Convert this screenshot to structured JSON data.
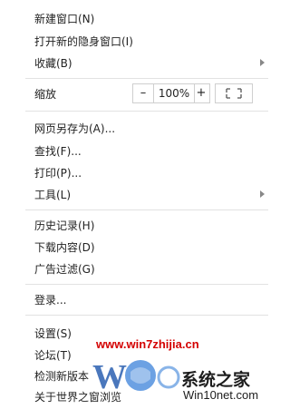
{
  "menu": {
    "new_window": "新建窗口(N)",
    "new_incognito": "打开新的隐身窗口(I)",
    "bookmarks": "收藏(B)",
    "zoom": {
      "label": "缩放",
      "minus": "–",
      "value": "100%",
      "plus": "+"
    },
    "save_as": "网页另存为(A)...",
    "find": "查找(F)...",
    "print": "打印(P)...",
    "tools": "工具(L)",
    "history": "历史记录(H)",
    "downloads": "下载内容(D)",
    "adblock": "广告过滤(G)",
    "login": "登录...",
    "settings": "设置(S)",
    "forum": "论坛(T)",
    "check_update": "检测新版本",
    "about": "关于世界之窗浏览"
  },
  "watermark": {
    "url": "www.win7zhijia.cn",
    "brand": "系统之家",
    "site": "Win10net.com"
  }
}
